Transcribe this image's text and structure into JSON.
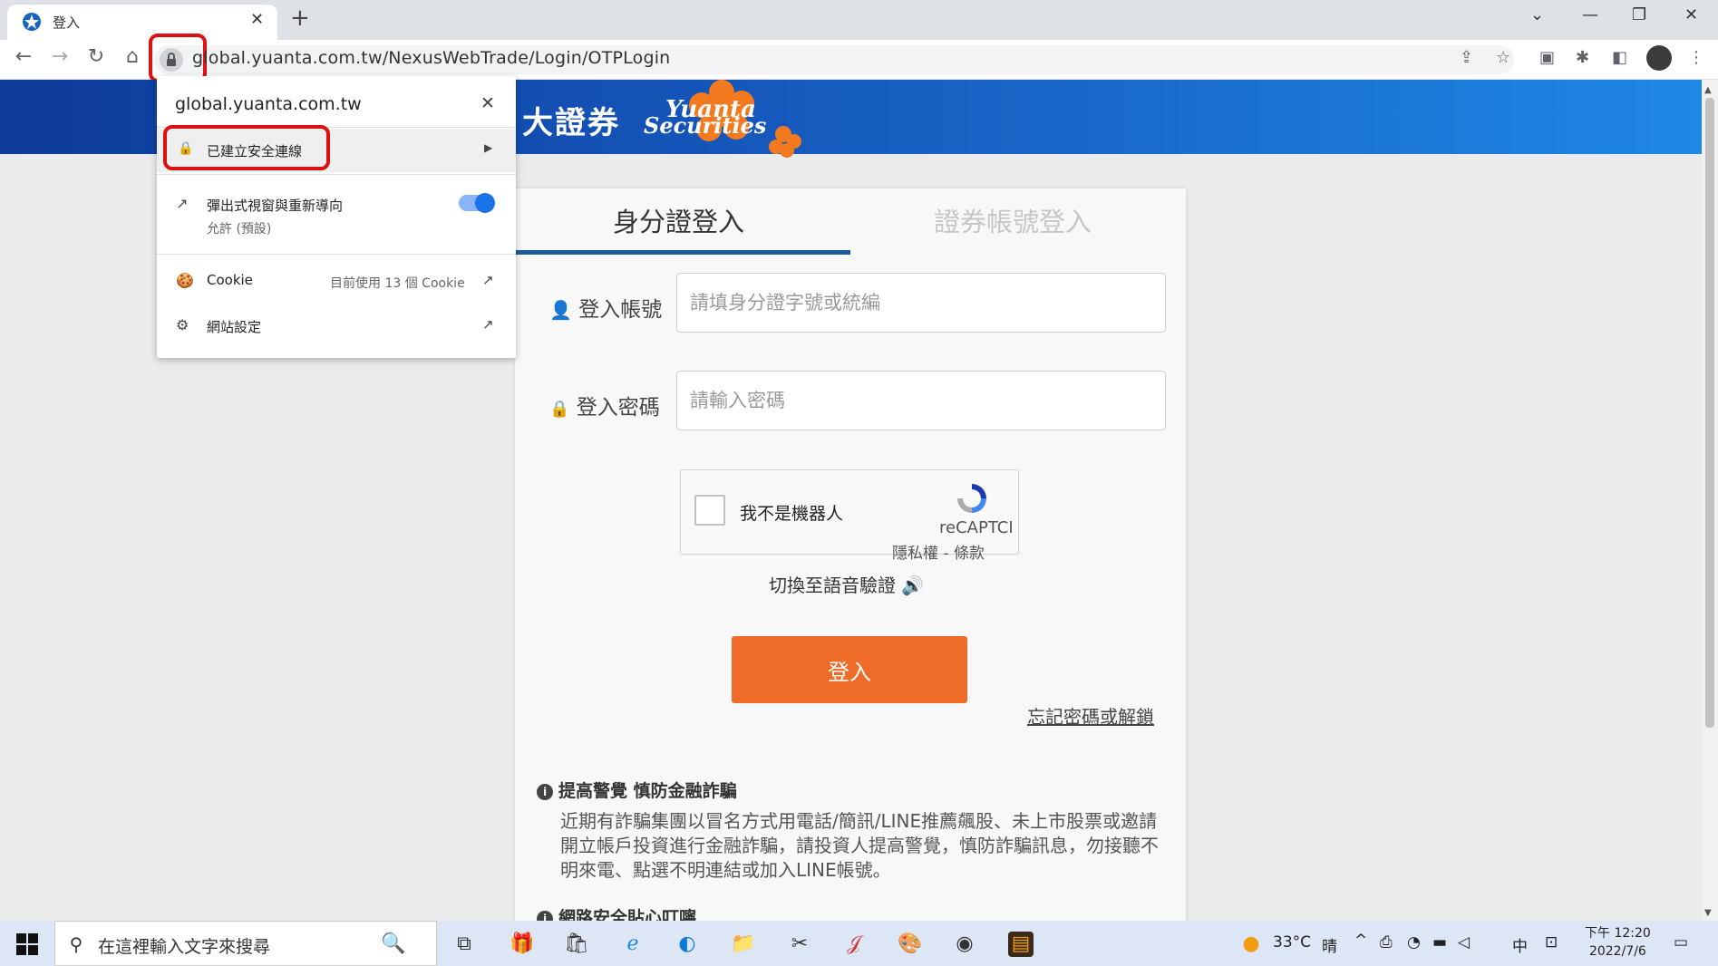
{
  "browser": {
    "tab_title": "登入",
    "url": "global.yuanta.com.tw/NexusWebTrade/Login/OTPLogin"
  },
  "brand": {
    "name_cn": "大證券",
    "name_en_1": "Yuanta",
    "name_en_2": "Securities"
  },
  "login": {
    "tab_id": "身分證登入",
    "tab_securities": "證券帳號登入",
    "account_label": "登入帳號",
    "account_placeholder": "請填身分證字號或統編",
    "password_label": "登入密碼",
    "password_placeholder": "請輸入密碼",
    "captcha_label": "我不是機器人",
    "captcha_brand": "reCAPTCI",
    "captcha_terms": "隱私權 - 條款",
    "audio_switch": "切換至語音驗證",
    "submit": "登入",
    "forgot": "忘記密碼或解鎖"
  },
  "notices": {
    "fraud_title": "提高警覺 慎防金融詐騙",
    "fraud_body": "近期有詐騙集團以冒名方式用電話/簡訊/LINE推薦飆股、未上市股票或邀請開立帳戶投資進行金融詐騙，請投資人提高警覺，慎防詐騙訊息，勿接聽不明來電、點選不明連結或加入LINE帳號。",
    "security_title": "網路安全貼心叮嚀"
  },
  "site_info": {
    "host": "global.yuanta.com.tw",
    "secure": "已建立安全連線",
    "popups_label": "彈出式視窗與重新導向",
    "popups_value": "允許 (預設)",
    "popups_enabled": true,
    "cookie_label": "Cookie",
    "cookie_value": "目前使用 13 個 Cookie",
    "site_settings": "網站設定"
  },
  "taskbar": {
    "search_placeholder": "在這裡輸入文字來搜尋",
    "temperature": "33°C",
    "weather": "晴",
    "ime": "中",
    "time": "下午 12:20",
    "date": "2022/7/6"
  },
  "colors": {
    "banner": "#1554b8",
    "login_button": "#ef6b28",
    "tab_underline": "#1a5c9e",
    "highlight_box": "#dd1111"
  }
}
